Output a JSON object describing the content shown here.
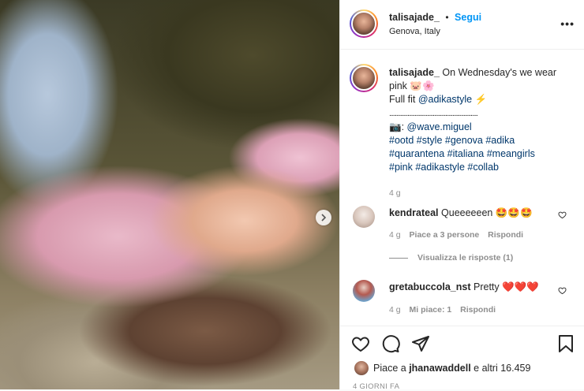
{
  "header": {
    "username": "talisajade_",
    "separator": "•",
    "follow_label": "Segui",
    "location": "Genova, Italy",
    "more_icon": "more-dots-icon"
  },
  "caption": {
    "username": "talisajade_",
    "line1": "On Wednesday's we wear pink",
    "line1_emoji": "🐷🌸",
    "line2_prefix": "Full fit",
    "line2_mention": "@adikastyle",
    "line2_emoji": "⚡",
    "divider": "...............................................................",
    "credit_emoji": "📷",
    "credit_mention": "@wave.miguel",
    "hashtags_line1": "#ootd #style #genova #adika",
    "hashtags_line2": "#quarantena #italiana #meangirls",
    "hashtags_line3": "#pink #adikastyle #collab",
    "time": "4 g"
  },
  "comments": [
    {
      "username": "kendrateal",
      "text": "Queeeeeen",
      "emoji": "🤩🤩🤩",
      "time": "4 g",
      "likes": "Piace a 3 persone",
      "reply": "Rispondi",
      "view_replies": "Visualizza le risposte (1)"
    },
    {
      "username": "gretabuccola_nst",
      "text": "Pretty",
      "emoji": "❤️❤️❤️",
      "time": "4 g",
      "likes": "Mi piace: 1",
      "reply": "Rispondi"
    }
  ],
  "footer": {
    "likes_prefix": "Piace a",
    "likes_user": "jhanawaddell",
    "likes_suffix": "e altri 16.459",
    "date": "4 GIORNI FA"
  },
  "colors": {
    "accent": "#0095f6",
    "link": "#00376b",
    "muted": "#8e8e8e",
    "heart_emoji": "#e0245e"
  }
}
